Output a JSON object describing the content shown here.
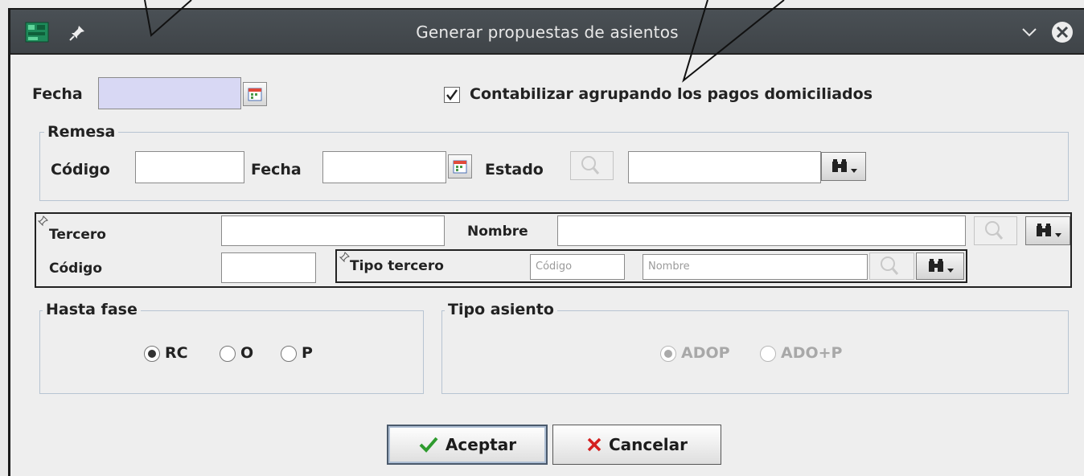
{
  "window": {
    "title": "Generar propuestas de asientos"
  },
  "top": {
    "fecha_label": "Fecha",
    "fecha_value": "",
    "agrupar_checked": true,
    "agrupar_label": "Contabilizar agrupando los pagos domiciliados"
  },
  "remesa": {
    "title": "Remesa",
    "codigo_label": "Código",
    "codigo_value": "",
    "fecha_label": "Fecha",
    "fecha_value": "",
    "estado_label": "Estado",
    "estado_value": ""
  },
  "tercero": {
    "tercero_label": "Tercero",
    "tercero_value": "",
    "nombre_label": "Nombre",
    "nombre_value": "",
    "codigo_label": "Código",
    "codigo_value": "",
    "tipo_label": "Tipo tercero",
    "tipo_codigo_placeholder": "Código",
    "tipo_nombre_placeholder": "Nombre"
  },
  "hasta_fase": {
    "title": "Hasta fase",
    "options": [
      "RC",
      "O",
      "P"
    ],
    "selected": "RC"
  },
  "tipo_asiento": {
    "title": "Tipo asiento",
    "options": [
      "ADOP",
      "ADO+P"
    ],
    "selected": "ADOP",
    "enabled": false
  },
  "buttons": {
    "accept": "Aceptar",
    "cancel": "Cancelar"
  },
  "colors": {
    "titlebar": "#444a4f",
    "fecha_bg": "#d8d8f4",
    "group_border": "#b7c4d2",
    "accept_check": "#2e9b2e",
    "cancel_x": "#d42020"
  }
}
